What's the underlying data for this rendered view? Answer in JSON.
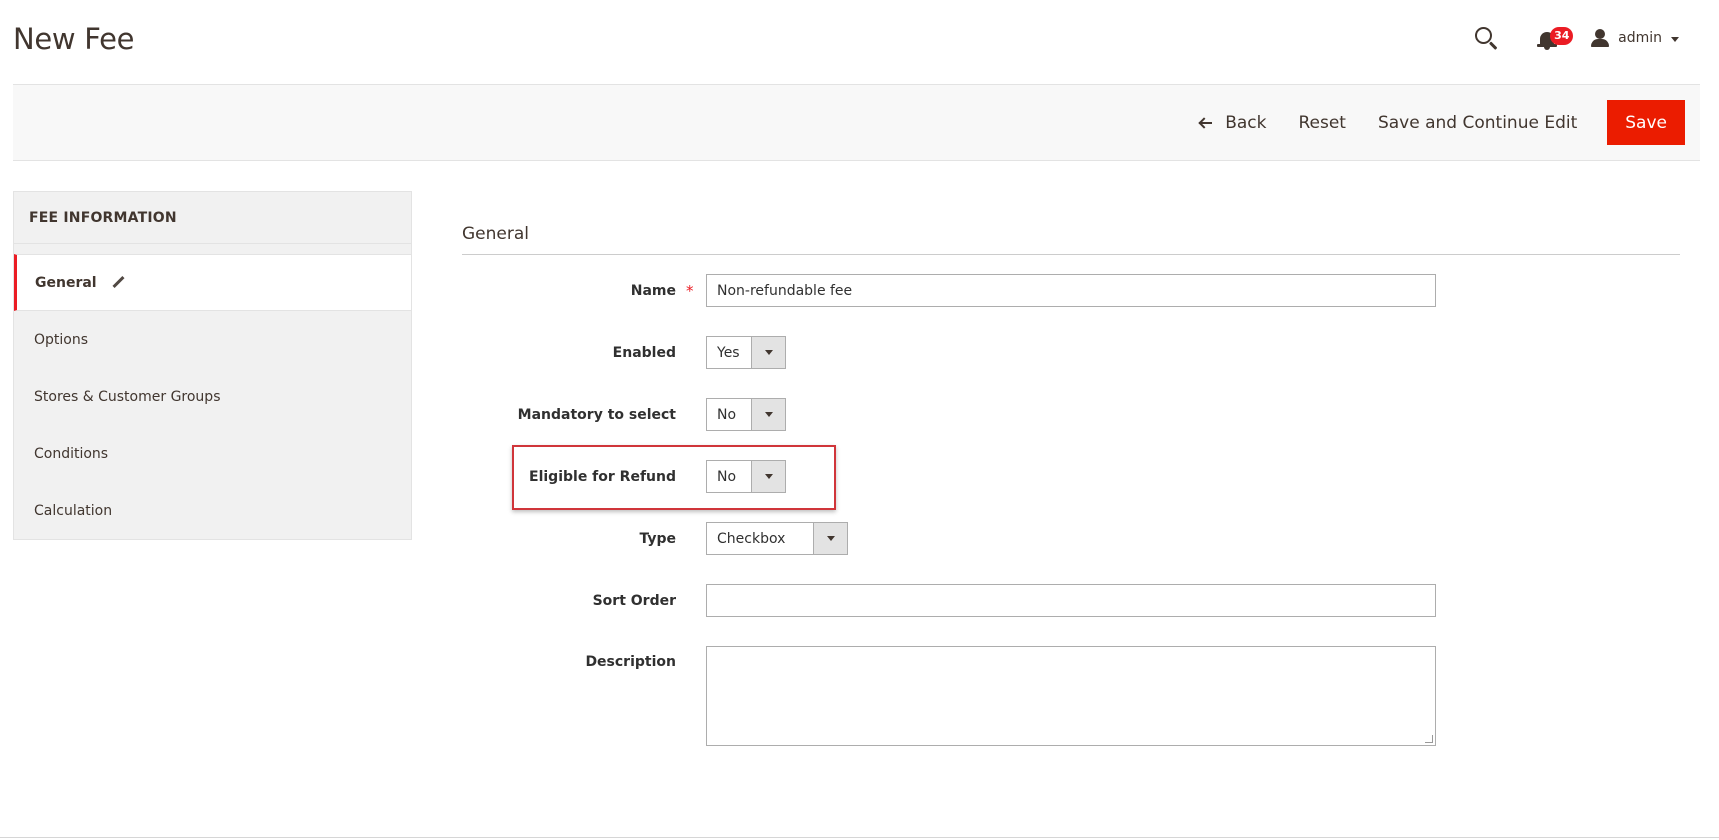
{
  "page": {
    "title": "New Fee"
  },
  "header": {
    "notifications_count": "34",
    "user_name": "admin",
    "icons": {
      "search": "search-icon",
      "notifications": "bell-icon",
      "user": "user-icon",
      "dropdown": "caret-down-icon"
    }
  },
  "toolbar": {
    "back_label": "Back",
    "reset_label": "Reset",
    "save_continue_label": "Save and Continue Edit",
    "save_label": "Save"
  },
  "nav": {
    "title": "FEE INFORMATION",
    "items": [
      {
        "label": "General",
        "active": true
      },
      {
        "label": "Options"
      },
      {
        "label": "Stores & Customer Groups"
      },
      {
        "label": "Conditions"
      },
      {
        "label": "Calculation"
      }
    ]
  },
  "form": {
    "section_title": "General",
    "required_marker": "*",
    "fields": {
      "name": {
        "label": "Name",
        "value": "Non-refundable fee"
      },
      "enabled": {
        "label": "Enabled",
        "value": "Yes"
      },
      "mandatory": {
        "label": "Mandatory to select",
        "value": "No"
      },
      "refund": {
        "label": "Eligible for Refund",
        "value": "No"
      },
      "type": {
        "label": "Type",
        "value": "Checkbox"
      },
      "sort_order": {
        "label": "Sort Order",
        "value": ""
      },
      "description": {
        "label": "Description",
        "value": ""
      }
    }
  },
  "colors": {
    "accent": "#eb1c00",
    "highlight_border": "#d0353a",
    "active_nav_marker": "#eb1c24"
  }
}
